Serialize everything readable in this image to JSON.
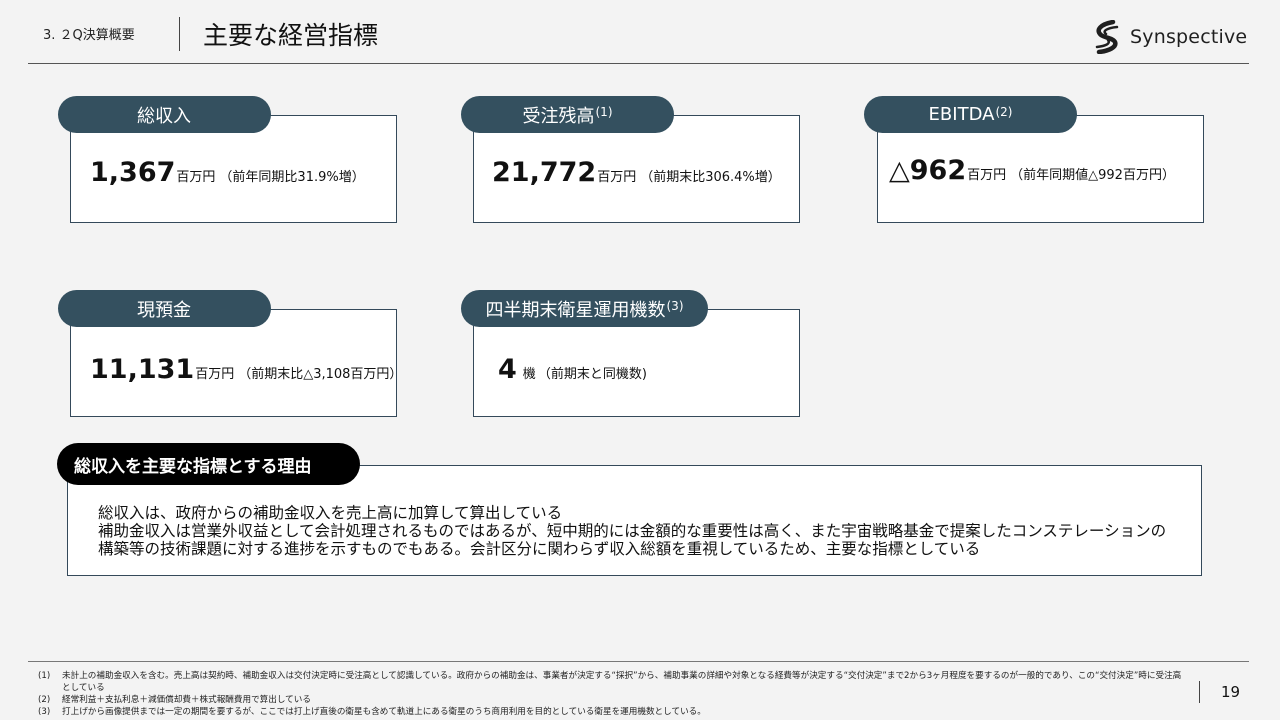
{
  "header": {
    "section": "3. ２Q決算概要",
    "title": "主要な経営指標",
    "logo_text": "Synspective"
  },
  "cards": [
    {
      "label": "総収入",
      "label_sup": "",
      "value": "1,367",
      "unit": "百万円",
      "note": "（前年同期比31.9%増）"
    },
    {
      "label": "受注残高",
      "label_sup": "(1)",
      "value": "21,772",
      "unit": "百万円",
      "note": "（前期末比306.4%増）"
    },
    {
      "label": "EBITDA ",
      "label_sup": "(2)",
      "value": "△962",
      "unit": "百万円",
      "note": "（前年同期値△992百万円）"
    },
    {
      "label": "現預金",
      "label_sup": "",
      "value": "11,131",
      "unit": "百万円",
      "note": "（前期末比△3,108百万円）"
    },
    {
      "label": "四半期末衛星運用機数",
      "label_sup": "(3)",
      "value": "4",
      "unit": "機",
      "note": "（前期末と同機数)"
    }
  ],
  "reason": {
    "title": "総収入を主要な指標とする理由",
    "line1": "総収入は、政府からの補助金収入を売上高に加算して算出している",
    "line2": "補助金収入は営業外収益として会計処理されるものではあるが、短中期的には金額的な重要性は高く、また宇宙戦略基金で提案したコンステレーションの構築等の技術課題に対する進捗を示すものでもある。会計区分に関わらず収入総額を重視しているため、主要な指標としている"
  },
  "footnotes": [
    {
      "num": "(1)",
      "text": "未計上の補助金収入を含む。売上高は契約時、補助金収入は交付決定時に受注高として認識している。政府からの補助金は、事業者が決定する“採択”から、補助事業の詳細や対象となる経費等が決定する“交付決定”まで2から3ヶ月程度を要するのが一般的であり、この“交付決定”時に受注高としている"
    },
    {
      "num": "(2)",
      "text": "経常利益＋支払利息＋減価償却費＋株式報酬費用で算出している"
    },
    {
      "num": "(3)",
      "text": "打上げから画像提供までは一定の期間を要するが、ここでは打上げ直後の衛星も含めて軌道上にある衛星のうち商用利用を目的としている衛星を運用機数としている。"
    }
  ],
  "page_number": "19",
  "colors": {
    "pill": "#34505f",
    "card_border": "#34495a",
    "reason_pill": "#000000",
    "background": "#f3f3f3"
  }
}
